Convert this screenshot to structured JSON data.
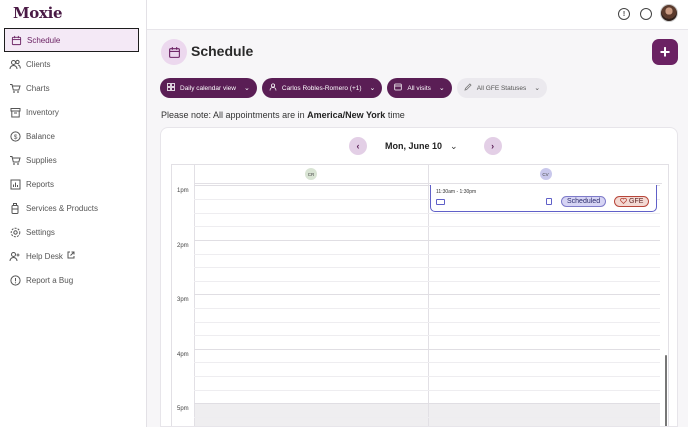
{
  "app": {
    "logo": "Moxie"
  },
  "sidebar": {
    "items": [
      {
        "label": "Schedule",
        "icon": "calendar-icon",
        "active": true
      },
      {
        "label": "Clients",
        "icon": "users-icon"
      },
      {
        "label": "Charts",
        "icon": "cart-icon"
      },
      {
        "label": "Inventory",
        "icon": "inventory-icon"
      },
      {
        "label": "Balance",
        "icon": "dollar-icon"
      },
      {
        "label": "Supplies",
        "icon": "cart-icon"
      },
      {
        "label": "Reports",
        "icon": "bar-chart-icon"
      },
      {
        "label": "Services & Products",
        "icon": "bottle-icon"
      },
      {
        "label": "Settings",
        "icon": "gear-icon"
      },
      {
        "label": "Help Desk",
        "icon": "help-icon",
        "external": true
      },
      {
        "label": "Report a Bug",
        "icon": "alert-icon"
      }
    ]
  },
  "header": {
    "title": "Schedule",
    "add_label": "+"
  },
  "filters": {
    "view": "Daily calendar view",
    "providers": "Carlos Robles-Romero (+1)",
    "visits": "All visits",
    "gfe": "All GFE Statuses"
  },
  "note": {
    "prefix": "Please note: All appointments are in ",
    "timezone": "America/New York",
    "suffix": " time"
  },
  "calendar": {
    "date": "Mon, June 10",
    "columns": [
      {
        "initials": "CR",
        "color": "#d9e4d4"
      },
      {
        "initials": "CV",
        "color": "#c9c8ec"
      }
    ],
    "hours": [
      "1pm",
      "2pm",
      "3pm",
      "4pm",
      "5pm"
    ],
    "appointment": {
      "time": "11:30am - 1:30pm",
      "status": "Scheduled",
      "gfe": "GFE"
    }
  },
  "colors": {
    "brand": "#6b2263",
    "brand_dark": "#5a1e55",
    "appt_border": "#6060c8"
  }
}
